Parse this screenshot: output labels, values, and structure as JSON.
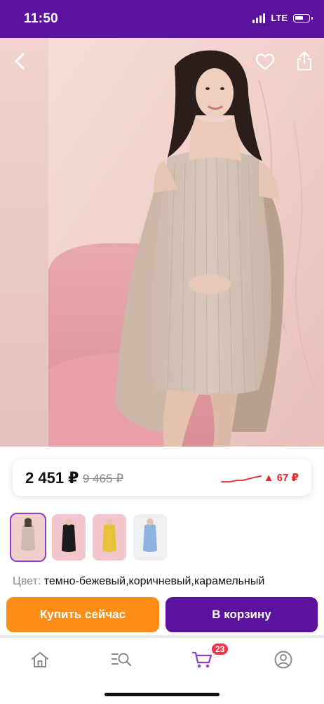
{
  "status_bar": {
    "time": "11:50",
    "network": "LTE",
    "background_color": "#5b129f"
  },
  "gallery": {
    "back_icon": "chevron-left-icon",
    "favorite_icon": "heart-icon",
    "share_icon": "share-icon",
    "image_search_icon": "image-search-icon"
  },
  "price_card": {
    "price": "2 451 ₽",
    "old_price": "9 465 ₽",
    "change": "▲ 67 ₽",
    "trend_color": "#e6232a"
  },
  "variants": [
    {
      "name": "темно-бежевый",
      "swatch": "#cdbcae"
    },
    {
      "name": "черный",
      "swatch": "#1b1b1b"
    },
    {
      "name": "желтый",
      "swatch": "#e9c23c"
    },
    {
      "name": "голубой",
      "swatch": "#8fb3e0"
    }
  ],
  "color_info": {
    "label": "Цвет:",
    "value": "темно-бежевый,коричневый,карамельный"
  },
  "actions": {
    "buy_now": "Купить сейчас",
    "add_to_cart": "В корзину",
    "buy_color": "#ff8e16",
    "cart_color": "#5b129f"
  },
  "tab_bar": {
    "tabs": [
      {
        "icon": "home-icon"
      },
      {
        "icon": "catalog-search-icon"
      },
      {
        "icon": "cart-icon"
      },
      {
        "icon": "profile-icon"
      }
    ],
    "cart_count": "23",
    "active_color": "#8a3fd1"
  }
}
